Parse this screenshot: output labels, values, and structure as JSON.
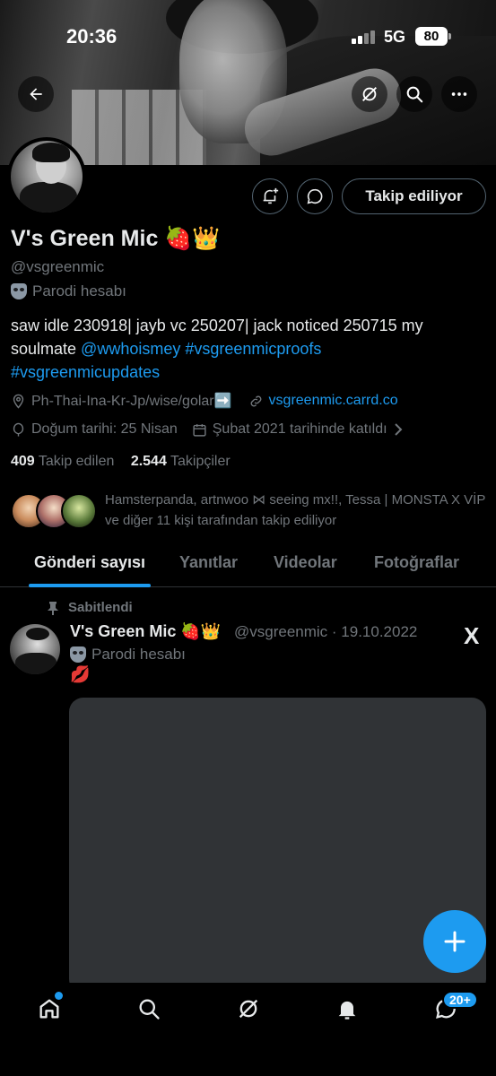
{
  "status_bar": {
    "time": "20:36",
    "network": "5G",
    "battery": "80"
  },
  "profile": {
    "display_name": "V's Green Mic 🍓👑",
    "handle": "@vsgreenmic",
    "parody_label": "Parodi hesabı",
    "bio_text": "saw idle 230918| jayb vc 250207| jack noticed 250715 my soulmate ",
    "bio_mention": "@wwhoismey",
    "bio_hashtag1": "#vsgreenmicproofs",
    "bio_hashtag2": "#vsgreenmicupdates",
    "location": "Ph-Thai-Ina-Kr-Jp/wise/golar➡️",
    "website": "vsgreenmic.carrd.co",
    "birthday": "Doğum tarihi: 25 Nisan",
    "joined": "Şubat 2021 tarihinde katıldı",
    "following_count": "409",
    "following_label": "Takip edilen",
    "followers_count": "2.544",
    "followers_label": "Takipçiler",
    "followed_by": "Hamsterpanda, artnwoo ⋈ seeing mx!!, Tessa | MONSTA X VİP ve diğer 11 kişi tarafından takip ediliyor",
    "follow_button": "Takip ediliyor"
  },
  "tabs": [
    {
      "label": "Gönderi sayısı",
      "active": true
    },
    {
      "label": "Yanıtlar",
      "active": false
    },
    {
      "label": "Videolar",
      "active": false
    },
    {
      "label": "Fotoğraflar",
      "active": false
    }
  ],
  "pinned_post": {
    "pinned_label": "Sabitlendi",
    "author_name": "V's Green Mic 🍓👑",
    "meta": "@vsgreenmic · 19.10.2022",
    "parody_label": "Parodi hesabı",
    "text": "💋",
    "source_logo": "X"
  },
  "bottom_nav": {
    "icons": [
      "home-icon",
      "search-icon",
      "grok-icon",
      "notifications-icon",
      "messages-icon"
    ],
    "messages_badge": "20+"
  },
  "colors": {
    "accent": "#1d9bf0",
    "background": "#000000",
    "muted": "#71767b",
    "text": "#e7e9ea"
  }
}
